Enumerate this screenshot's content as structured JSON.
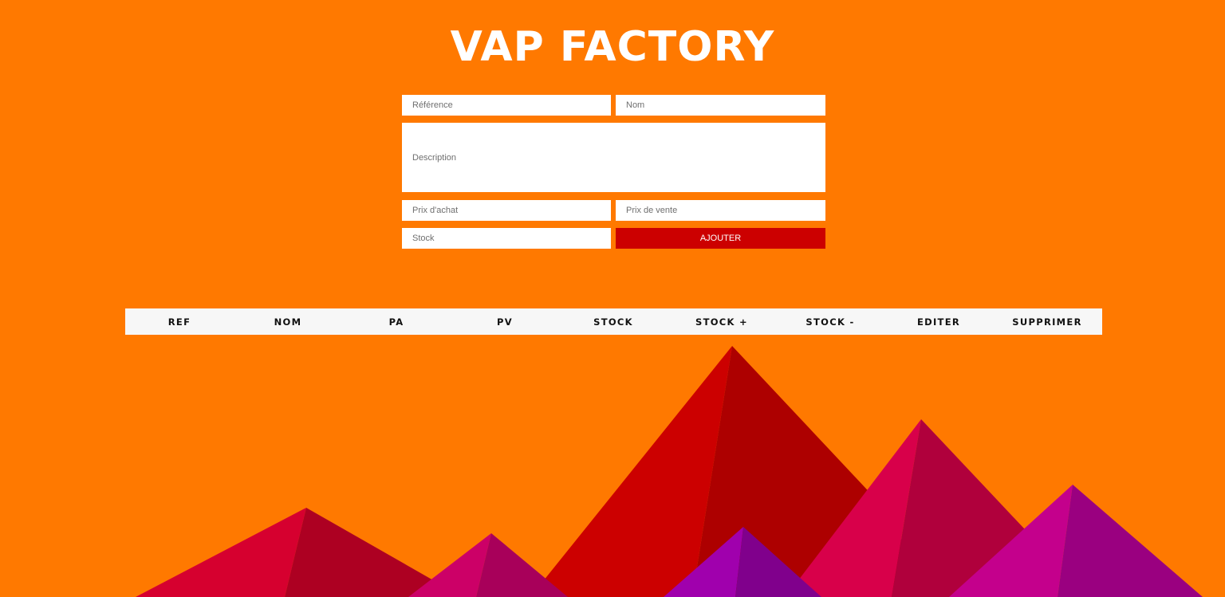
{
  "app": {
    "title": "VAP FACTORY"
  },
  "form": {
    "reference_placeholder": "Référence",
    "nom_placeholder": "Nom",
    "description_placeholder": "Description",
    "prix_achat_placeholder": "Prix d'achat",
    "prix_vente_placeholder": "Prix de vente",
    "stock_placeholder": "Stock",
    "submit_label": "AJOUTER"
  },
  "table": {
    "columns": [
      "REF",
      "NOM",
      "PA",
      "PV",
      "STOCK",
      "STOCK +",
      "STOCK -",
      "EDITER",
      "SUPPRIMER"
    ],
    "rows": []
  },
  "colors": {
    "background": "#ff7900",
    "button": "#cc0000",
    "header_row": "#f7f7f7",
    "mountain_red": "#cc0000",
    "mountain_dark_red": "#ad0000",
    "mountain_crimson": "#d8004a",
    "mountain_magenta": "#c4008c",
    "mountain_purple": "#a000ad"
  }
}
